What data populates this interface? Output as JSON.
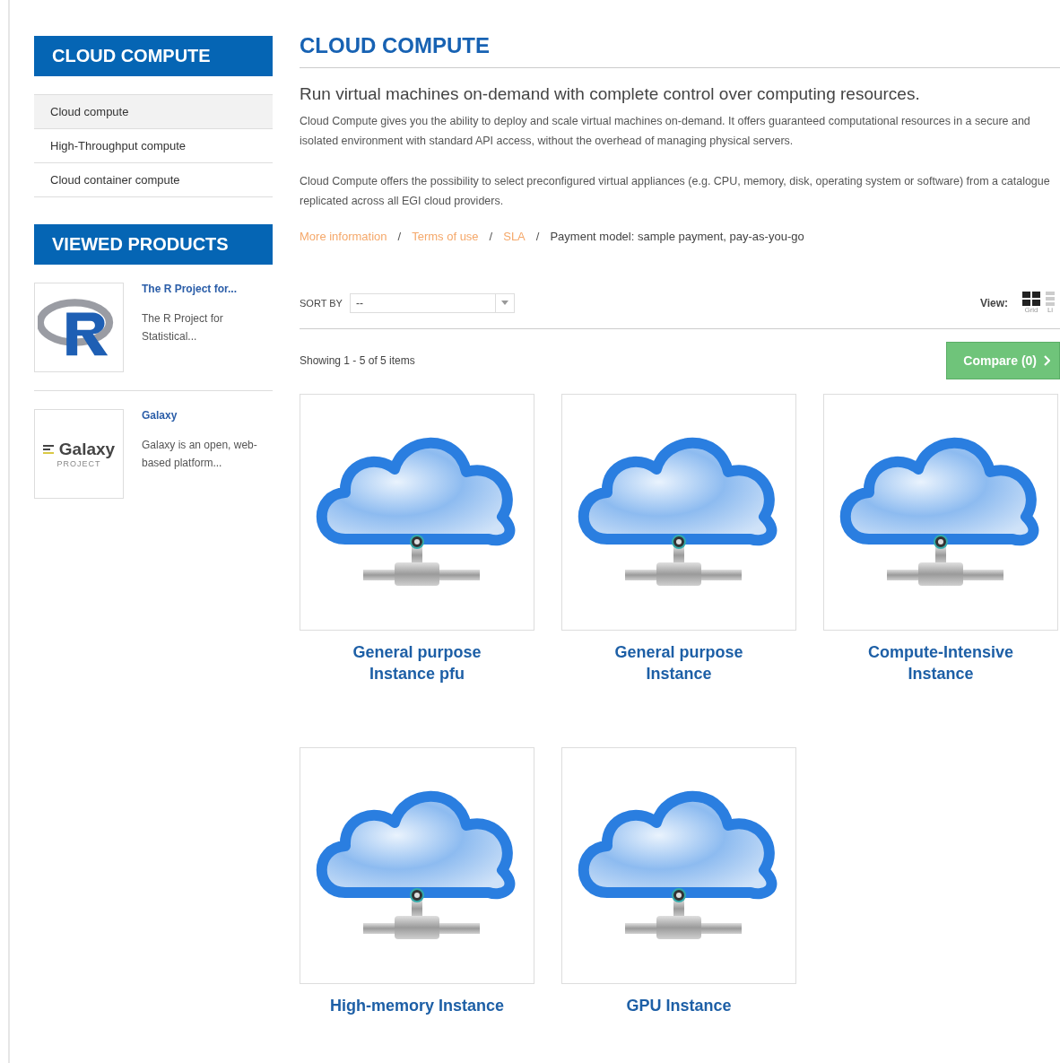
{
  "sidebar": {
    "category_title": "CLOUD COMPUTE",
    "items": [
      {
        "label": "Cloud compute",
        "selected": true
      },
      {
        "label": "High-Throughput compute",
        "selected": false
      },
      {
        "label": "Cloud container compute",
        "selected": false
      }
    ],
    "viewed_title": "VIEWED PRODUCTS",
    "viewed_products": [
      {
        "kind": "r",
        "name": "The R Project for...",
        "description": "The R Project for Statistical..."
      },
      {
        "kind": "galaxy",
        "logo_text": "Galaxy",
        "logo_subtext": "PROJECT",
        "name": "Galaxy",
        "description": "Galaxy is an open, web-based platform..."
      }
    ]
  },
  "main": {
    "title": "CLOUD COMPUTE",
    "subtitle": "Run virtual machines on-demand with complete control over computing resources.",
    "paragraphs": [
      "Cloud Compute gives you the ability to deploy and scale virtual machines on-demand. It offers guaranteed computational resources in a secure and isolated environment with standard API access, without the overhead of managing physical servers.",
      "Cloud Compute offers the possibility to select preconfigured virtual appliances (e.g. CPU, memory, disk, operating system or software) from a catalogue replicated across all EGI cloud providers."
    ],
    "links": [
      "More information",
      "Terms of use",
      "SLA"
    ],
    "separator": "/",
    "payment_model": "Payment model: sample payment, pay-as-you-go",
    "sort_label": "SORT BY",
    "sort_value": "--",
    "view_label": "View:",
    "views": [
      {
        "kind": "grid",
        "label": "Grid",
        "selected": true
      },
      {
        "kind": "list",
        "label": "Li",
        "selected": false
      }
    ],
    "showing": "Showing 1 - 5 of 5 items",
    "compare_button": "Compare (0)",
    "products": [
      {
        "name": "General purpose Instance pfu"
      },
      {
        "name": "General purpose Instance"
      },
      {
        "name": "Compute-Intensive Instance"
      },
      {
        "name": "High-memory Instance"
      },
      {
        "name": "GPU Instance"
      }
    ]
  }
}
